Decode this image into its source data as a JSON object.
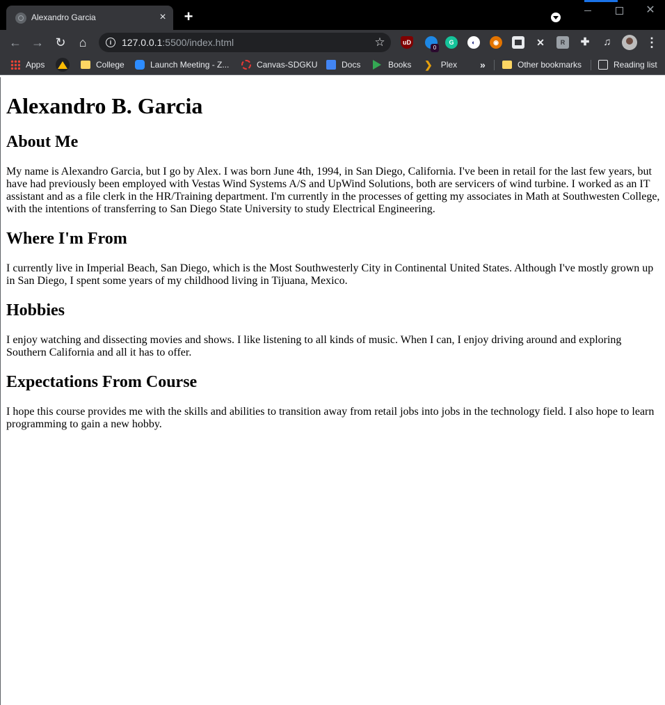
{
  "browser": {
    "tab_title": "Alexandro Garcia",
    "tab_close": "×",
    "new_tab": "+",
    "url_host": "127.0.0.1",
    "url_rest": ":5500/index.html",
    "extension_badge": "0",
    "bookmarks": {
      "apps": "Apps",
      "college": "College",
      "zoom": "Launch Meeting - Z...",
      "canvas": "Canvas-SDGKU",
      "docs": "Docs",
      "books": "Books",
      "plex": "Plex",
      "more": "»",
      "other": "Other bookmarks",
      "reading": "Reading list"
    }
  },
  "page": {
    "name": "Alexandro B. Garcia",
    "sections": [
      {
        "heading": "About Me",
        "body": "My name is Alexandro Garcia, but I go by Alex. I was born June 4th, 1994, in San Diego, California. I've been in retail for the last few years, but have had previously been employed with Vestas Wind Systems A/S and UpWind Solutions, both are servicers of wind turbine. I worked as an IT assistant and as a file clerk in the HR/Training department. I'm currently in the processes of getting my associates in Math at Southwesten College, with the intentions of transferring to San Diego State University to study Electrical Engineering."
      },
      {
        "heading": "Where I'm From",
        "body": "I currently live in Imperial Beach, San Diego, which is the Most Southwesterly City in Continental United States. Although I've mostly grown up in San Diego, I spent some years of my childhood living in Tijuana, Mexico."
      },
      {
        "heading": "Hobbies",
        "body": "I enjoy watching and dissecting movies and shows. I like listening to all kinds of music. When I can, I enjoy driving around and exploring Southern California and all it has to offer."
      },
      {
        "heading": "Expectations From Course",
        "body": "I hope this course provides me with the skills and abilities to transition away from retail jobs into jobs in the technology field. I also hope to learn programming to gain a new hobby."
      }
    ]
  }
}
